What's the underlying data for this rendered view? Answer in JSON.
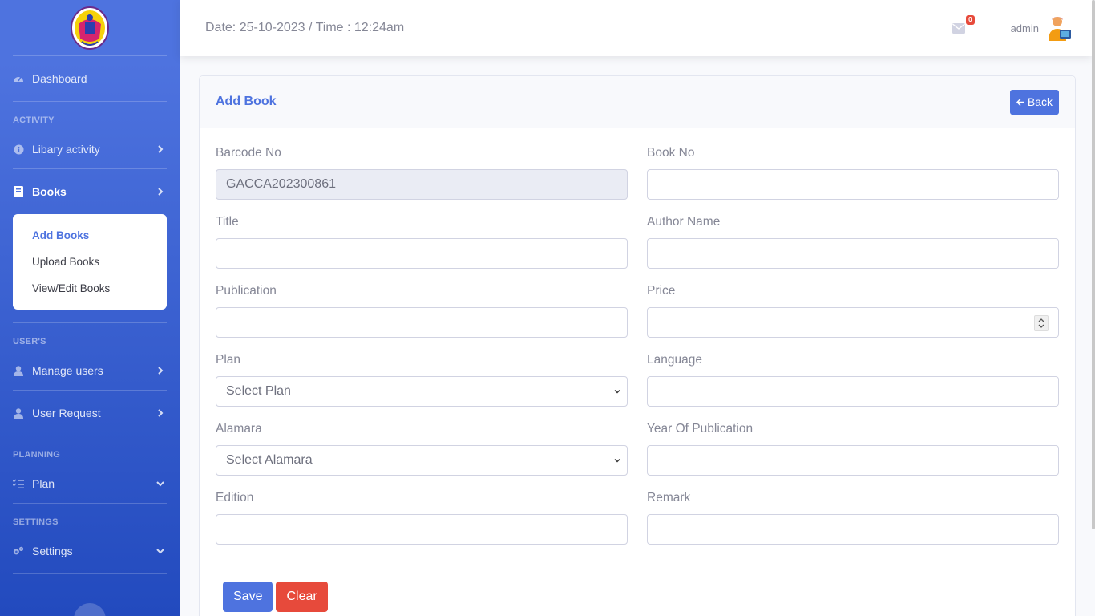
{
  "sidebar": {
    "dashboard": "Dashboard",
    "heading_activity": "ACTIVITY",
    "library_activity": "Libary activity",
    "books": "Books",
    "books_submenu": [
      "Add Books",
      "Upload Books",
      "View/Edit Books"
    ],
    "heading_users": "USER'S",
    "manage_users": "Manage users",
    "user_request": "User Request",
    "heading_planning": "PLANNING",
    "plan": "Plan",
    "heading_settings": "SETTINGS",
    "settings": "Settings"
  },
  "topbar": {
    "datetime": "Date: 25-10-2023 / Time : 12:24am",
    "mail_count": "0",
    "username": "admin"
  },
  "card": {
    "title": "Add Book",
    "back_label": "Back"
  },
  "form": {
    "barcode_label": "Barcode No",
    "barcode_value": "GACCA202300861",
    "book_no_label": "Book No",
    "title_label": "Title",
    "author_label": "Author Name",
    "publication_label": "Publication",
    "price_label": "Price",
    "plan_label": "Plan",
    "plan_value": "Select Plan",
    "language_label": "Language",
    "alamara_label": "Alamara",
    "alamara_value": "Select Alamara",
    "year_label": "Year Of Publication",
    "edition_label": "Edition",
    "remark_label": "Remark",
    "save_label": "Save",
    "clear_label": "Clear"
  },
  "colors": {
    "primary": "#4e73df",
    "danger": "#e74a3b",
    "sidebar_gradient_end": "#224abe"
  }
}
